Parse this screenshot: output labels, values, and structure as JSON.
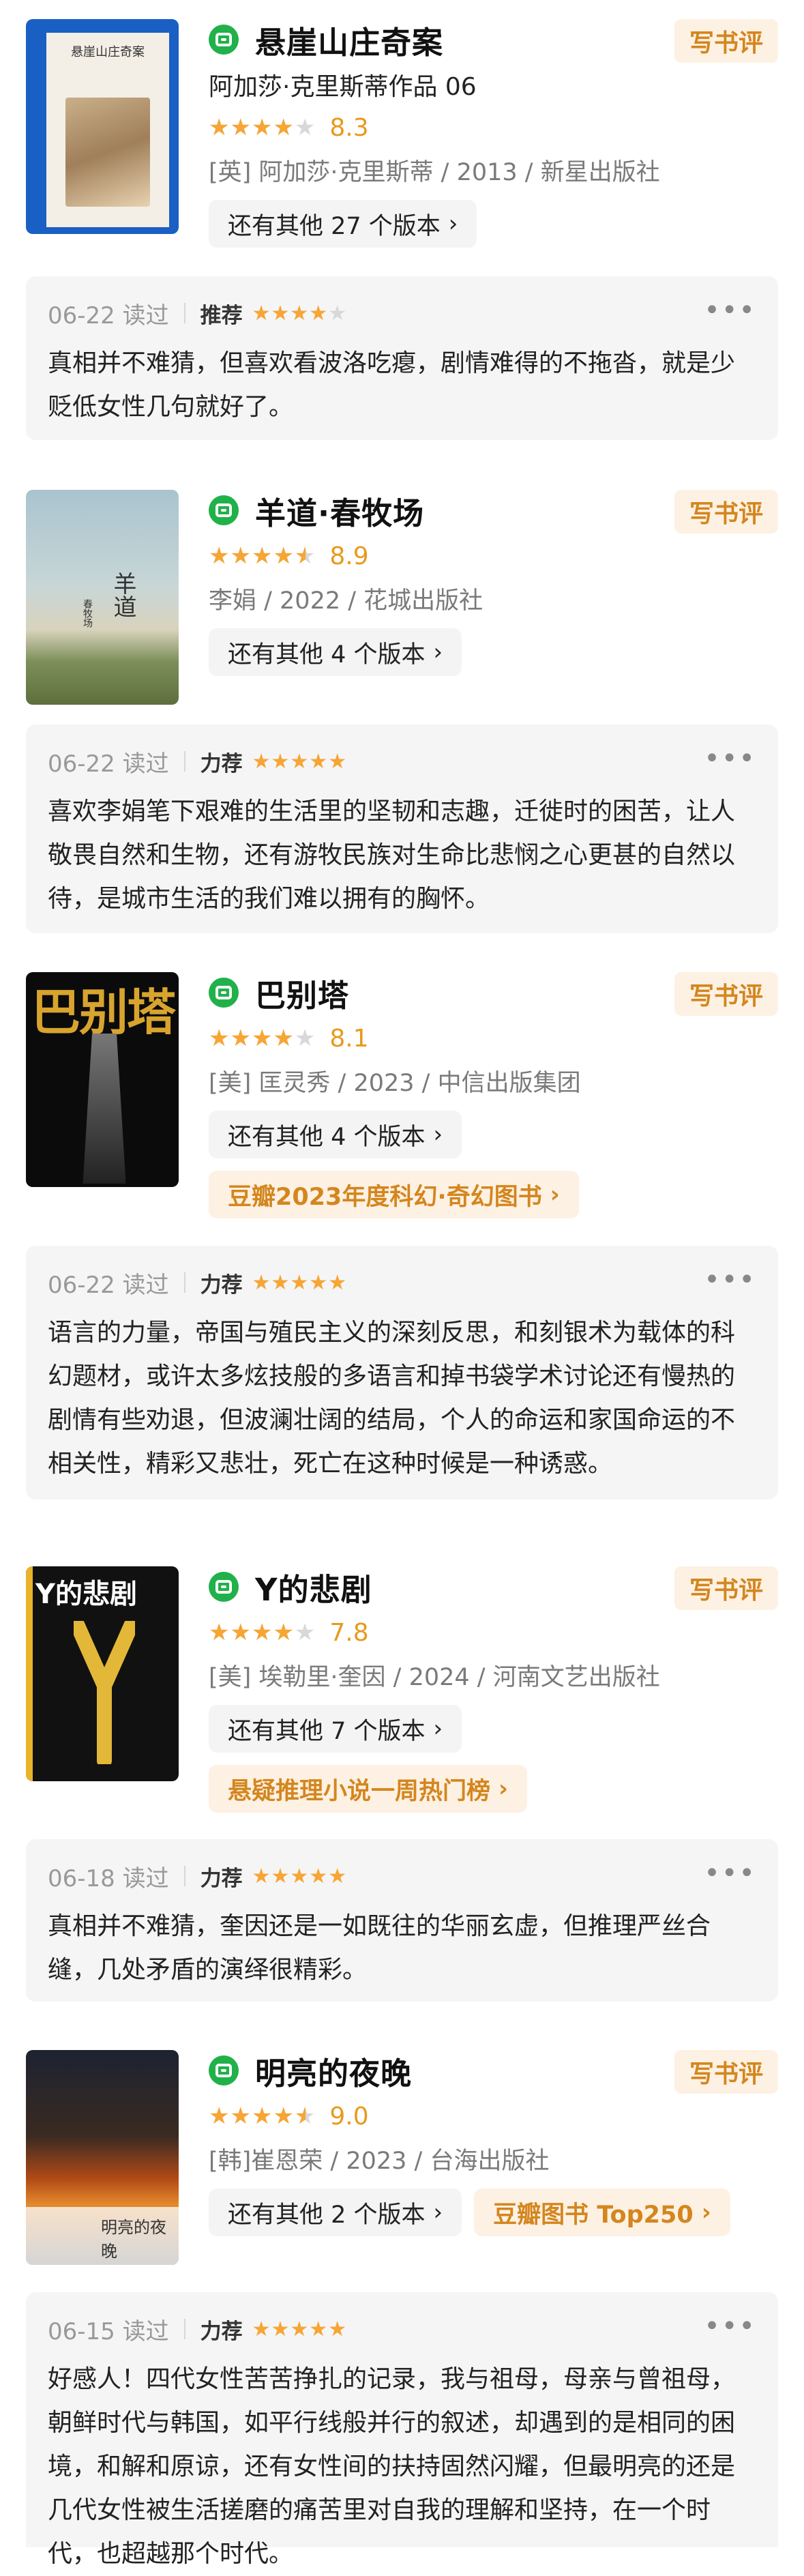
{
  "write_review_label": "写书评",
  "books": [
    {
      "title": "悬崖山庄奇案",
      "subtitle": "阿加莎·克里斯蒂作品 06",
      "stars_fraction": 0.8,
      "score": "8.3",
      "meta": "[英] 阿加莎·克里斯蒂 / 2013 / 新星出版社",
      "versions": "还有其他 27 个版本",
      "cover_text": "悬崖山庄奇案",
      "review": {
        "date": "06-22 读过",
        "label": "推荐",
        "stars_fraction": 0.8,
        "text": "真相并不难猜，但喜欢看波洛吃瘪，剧情难得的不拖沓，就是少贬低女性几句就好了。"
      }
    },
    {
      "title": "羊道·春牧场",
      "stars_fraction": 0.9,
      "score": "8.9",
      "meta": "李娟 / 2022 / 花城出版社",
      "versions": "还有其他 4 个版本",
      "cover_text": "羊道",
      "cover_sub": "春牧场",
      "review": {
        "date": "06-22 读过",
        "label": "力荐",
        "stars_fraction": 1.0,
        "text": "喜欢李娟笔下艰难的生活里的坚韧和志趣，迁徙时的困苦，让人敬畏自然和生物，还有游牧民族对生命比悲悯之心更甚的自然以待，是城市生活的我们难以拥有的胸怀。"
      }
    },
    {
      "title": "巴别塔",
      "stars_fraction": 0.8,
      "score": "8.1",
      "meta": "[美] 匡灵秀 / 2023 / 中信出版集团",
      "versions": "还有其他 4 个版本",
      "tag": "豆瓣2023年度科幻·奇幻图书",
      "cover_text": "巴别塔",
      "review": {
        "date": "06-22 读过",
        "label": "力荐",
        "stars_fraction": 1.0,
        "text": "语言的力量，帝国与殖民主义的深刻反思，和刻银术为载体的科幻题材，或许太多炫技般的多语言和掉书袋学术讨论还有慢热的剧情有些劝退，但波澜壮阔的结局，个人的命运和家国命运的不相关性，精彩又悲壮，死亡在这种时候是一种诱惑。"
      }
    },
    {
      "title": "Y的悲剧",
      "stars_fraction": 0.8,
      "score": "7.8",
      "meta": "[美] 埃勒里·奎因 / 2024 / 河南文艺出版社",
      "versions": "还有其他 7 个版本",
      "tag": "悬疑推理小说一周热门榜",
      "cover_text": "Y的悲剧",
      "review": {
        "date": "06-18 读过",
        "label": "力荐",
        "stars_fraction": 1.0,
        "text": "真相并不难猜，奎因还是一如既往的华丽玄虚，但推理严丝合缝，几处矛盾的演绎很精彩。"
      }
    },
    {
      "title": "明亮的夜晚",
      "stars_fraction": 0.9,
      "score": "9.0",
      "meta": "[韩]崔恩荣 / 2023 / 台海出版社",
      "versions": "还有其他 2 个版本",
      "tag": "豆瓣图书 Top250",
      "cover_text": "明亮的夜晚",
      "review": {
        "date": "06-15 读过",
        "label": "力荐",
        "stars_fraction": 1.0,
        "text": "好感人！四代女性苦苦挣扎的记录，我与祖母，母亲与曾祖母，朝鲜时代与韩国，如平行线般并行的叙述，却遇到的是相同的困境，和解和原谅，还有女性间的扶持固然闪耀，但最明亮的还是几代女性被生活搓磨的痛苦里对自我的理解和坚持，在一个时代，也超越那个时代。"
      }
    }
  ]
}
